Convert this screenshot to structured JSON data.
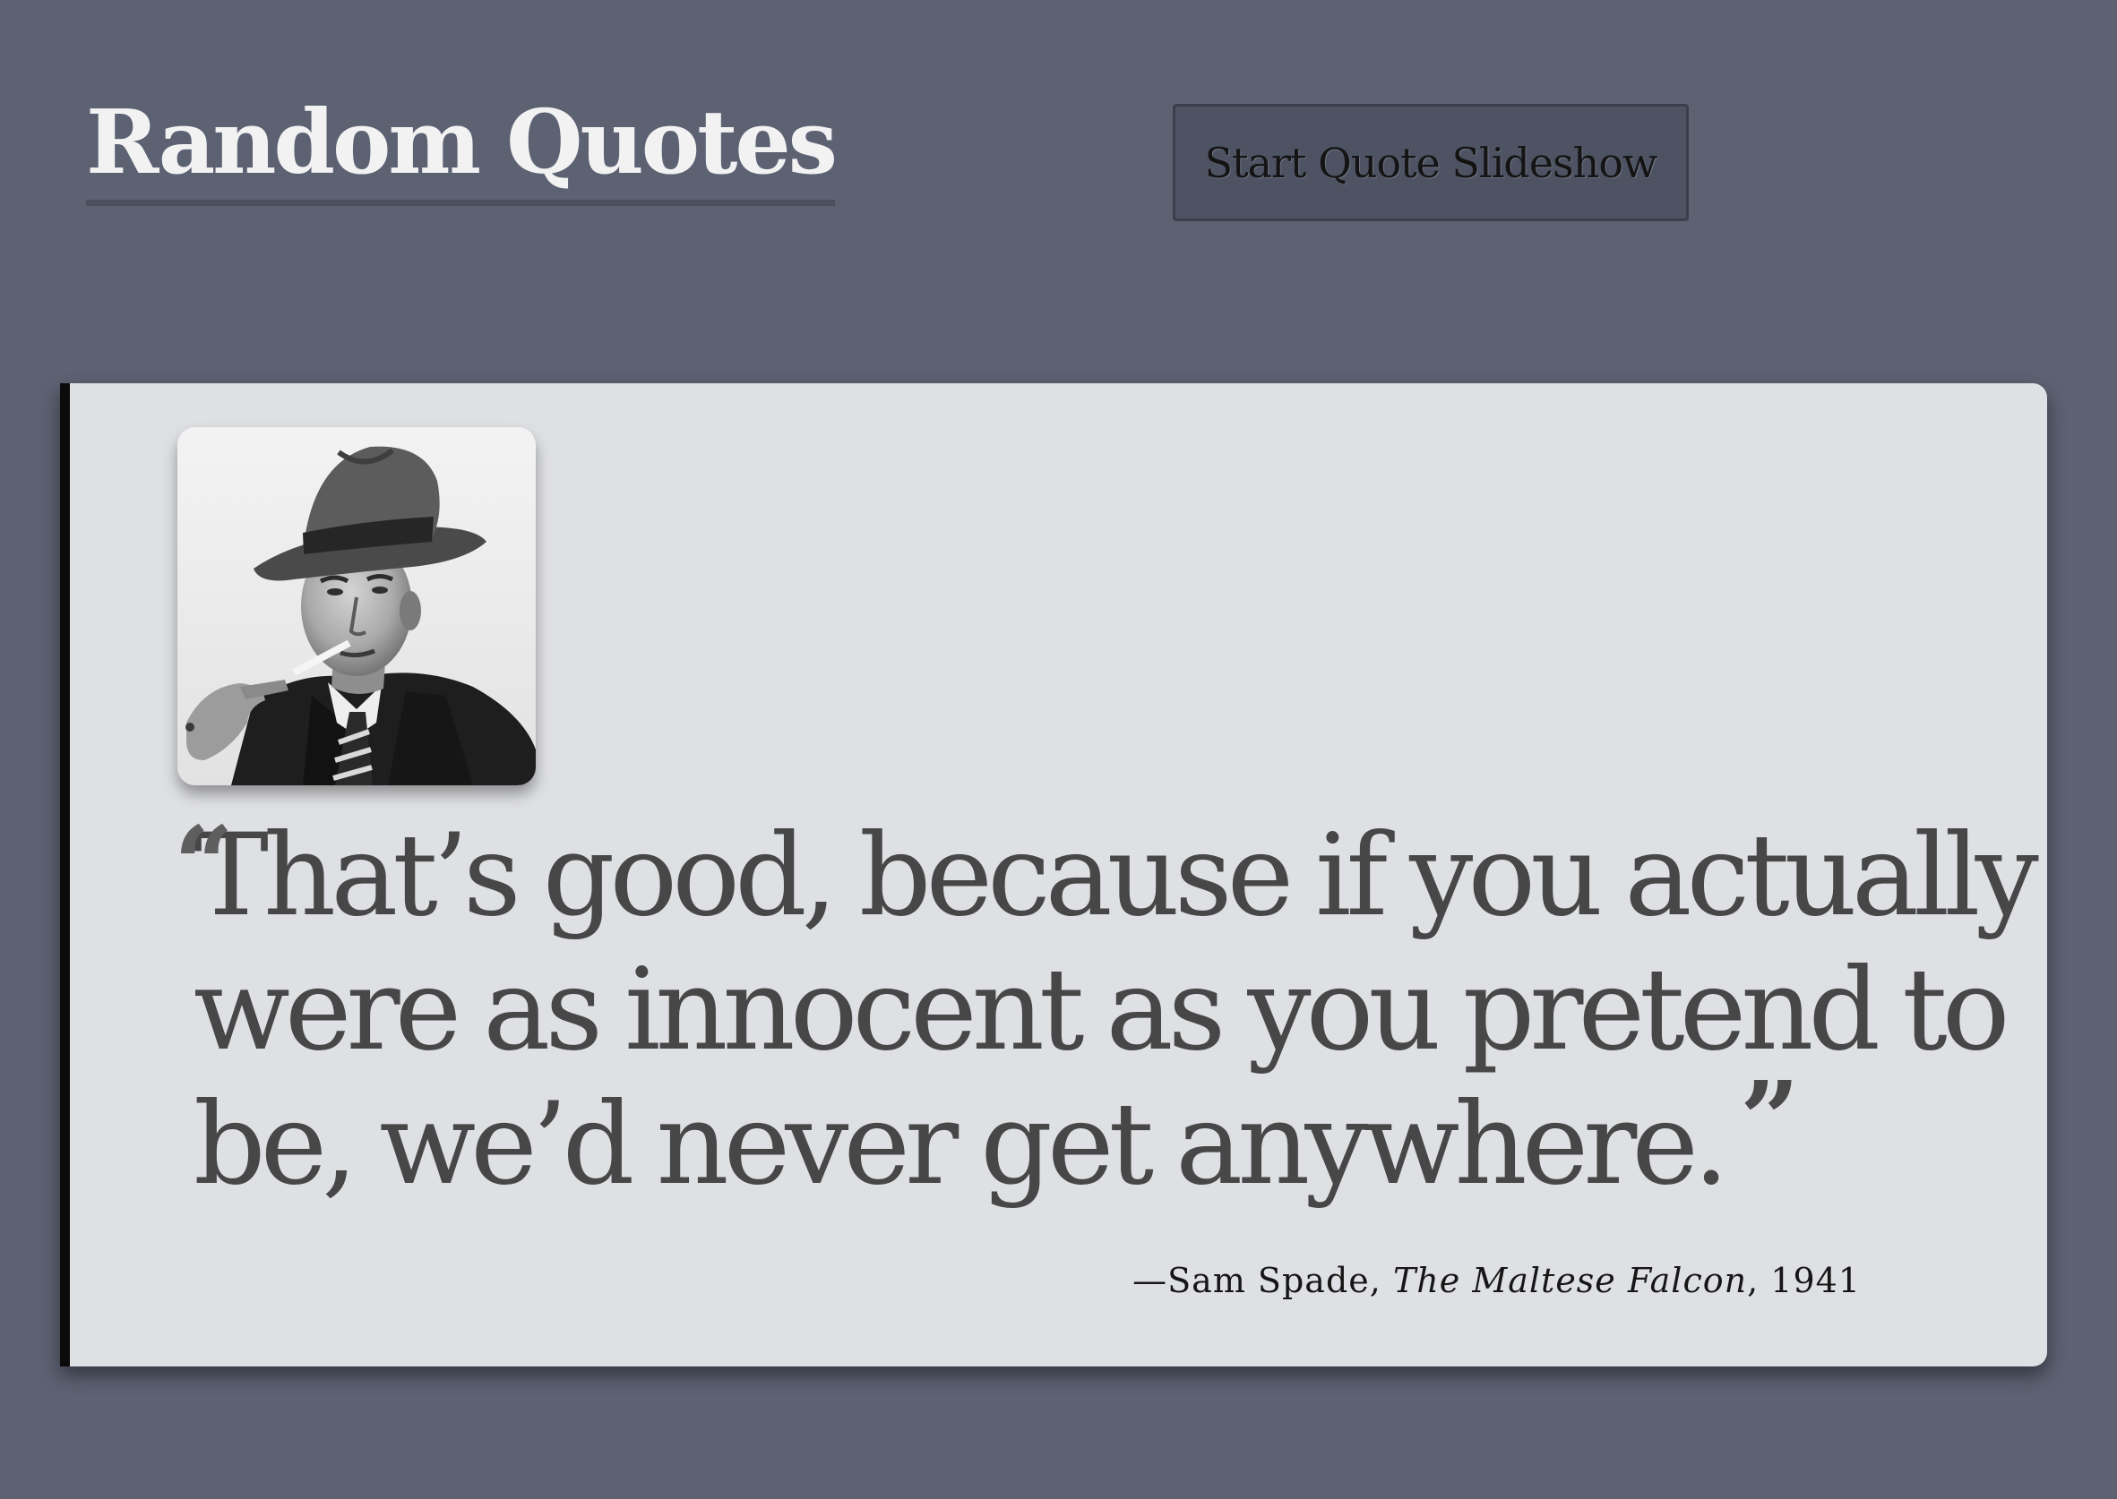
{
  "header": {
    "title": "Random Quotes",
    "slideshow_button_label": "Start Quote Slideshow"
  },
  "quote": {
    "open_mark": "“",
    "text": "That’s good, because if you actually were as innocent as you pretend to be, we’d never get anywhere.",
    "close_mark": "”",
    "attribution": {
      "dash": "—",
      "speaker": "Sam Spade",
      "separator": ", ",
      "work": "The Maltese Falcon",
      "separator2": ", ",
      "year": "1941"
    },
    "portrait_icon": "person-in-fedora-portrait"
  },
  "colors": {
    "background": "#5d6273",
    "card": "#dfe0e3",
    "card_accent_border": "#0b0b0b",
    "title": "#f2f2f3",
    "button": "#4e5363",
    "quote_text": "#474747"
  }
}
